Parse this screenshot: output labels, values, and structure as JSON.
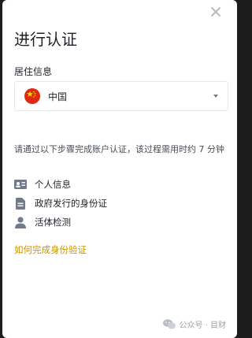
{
  "page": {
    "title": "进行认证"
  },
  "residence": {
    "label": "居住信息",
    "selected": "中国"
  },
  "description": "请通过以下步骤完成账户认证，该过程需用时约 7 分钟",
  "steps": [
    {
      "icon": "id-card-icon",
      "label": "个人信息"
    },
    {
      "icon": "document-icon",
      "label": "政府发行的身份证"
    },
    {
      "icon": "person-icon",
      "label": "活体检测"
    }
  ],
  "help_link": "如何完成身份验证",
  "watermark": "公众号 · 目财",
  "colors": {
    "link": "#c99400",
    "flag": "#de2910",
    "icon": "#707a8a"
  }
}
